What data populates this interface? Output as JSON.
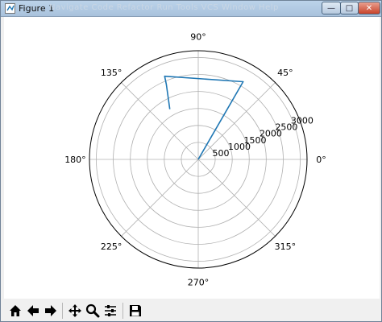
{
  "window": {
    "title": "Figure 1",
    "menu_ghost_text": "Navigate   Code   Refactor   Run   Tools   VCS   Window   Help",
    "minimize_glyph": "—",
    "maximize_glyph": "□",
    "close_glyph": "✕"
  },
  "toolbar": {
    "buttons": [
      "home-icon",
      "back-arrow-icon",
      "forward-arrow-icon",
      "pan-icon",
      "zoom-icon",
      "configure-subplots-icon",
      "save-icon"
    ]
  },
  "chart_data": {
    "type": "line",
    "projection": "polar",
    "angle_unit": "degrees",
    "angle_ticks": [
      "0°",
      "45°",
      "90°",
      "135°",
      "180°",
      "225°",
      "270°",
      "315°"
    ],
    "radial_ticks": [
      500,
      1000,
      1500,
      2000,
      2500,
      3000
    ],
    "radial_tick_labels": [
      "500",
      "1000",
      "1500",
      "2000",
      "2500",
      "3000"
    ],
    "rlim": [
      0,
      3200
    ],
    "radial_label_angle_deg": 22.5,
    "grid": true,
    "series": [
      {
        "color": "#1f77b4",
        "theta_deg": [
          0,
          60,
          112,
          113,
          119.5
        ],
        "r": [
          0,
          2640,
          2640,
          2400,
          1700
        ]
      }
    ]
  },
  "colors": {
    "line": "#1f77b4",
    "grid": "#b0b0b0",
    "spine": "#000000",
    "titlebar": "#bcd3ea"
  }
}
